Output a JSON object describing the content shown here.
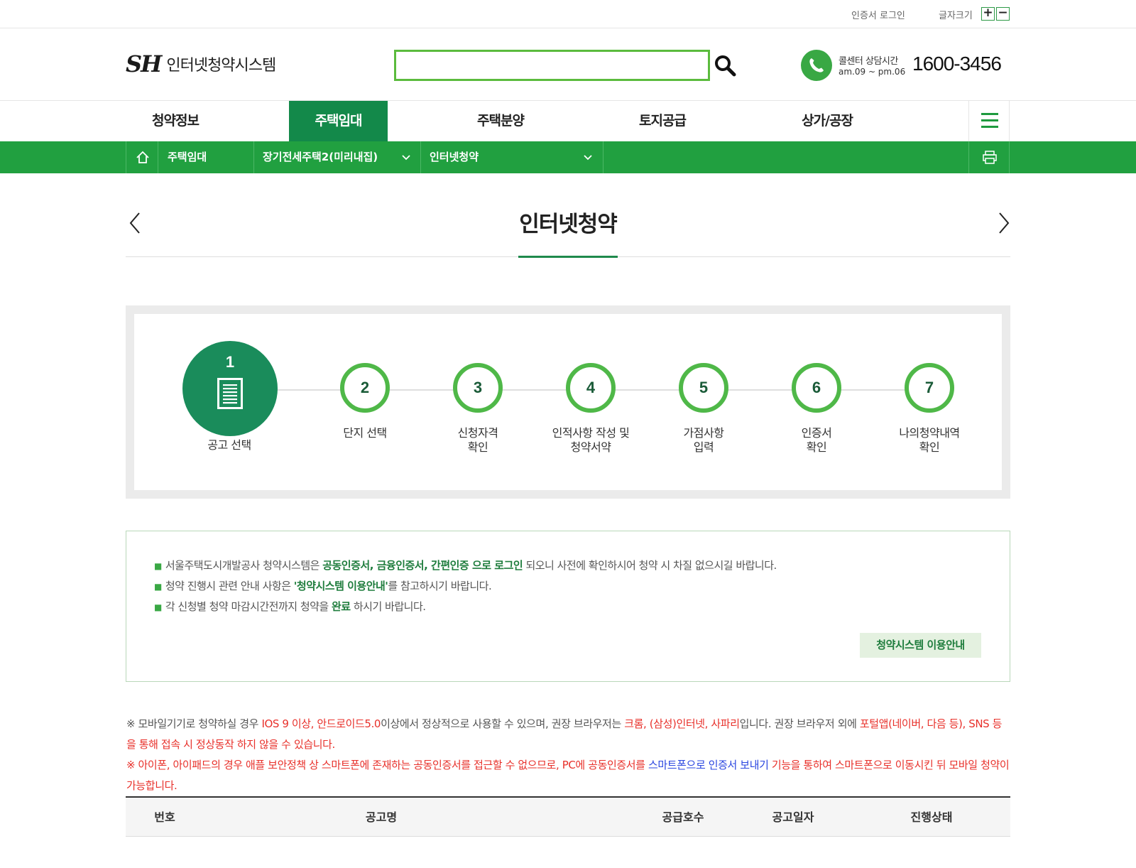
{
  "util": {
    "login": "인증서 로그인",
    "font_size_label": "글자크기",
    "font_plus": "+",
    "font_minus": "−"
  },
  "header": {
    "logo_mark": "SH",
    "logo_text": "인터넷청약시스템",
    "search_placeholder": "",
    "call_label": "콜센터 상담시간",
    "call_hours": "am.09 ~ pm.06",
    "call_number": "1600-3456"
  },
  "gnb": {
    "items": [
      "청약정보",
      "주택임대",
      "주택분양",
      "토지공급",
      "상가/공장"
    ],
    "active_index": 1
  },
  "location": {
    "home": "주택임대",
    "depth2": "장기전세주택2(미리내집)",
    "depth3": "인터넷청약"
  },
  "page": {
    "title": "인터넷청약"
  },
  "steps": [
    {
      "num": "1",
      "label": "공고 선택",
      "active": true
    },
    {
      "num": "2",
      "label": "단지 선택"
    },
    {
      "num": "3",
      "label": "신청자격\n확인"
    },
    {
      "num": "4",
      "label": "인적사항 작성 및\n청약서약"
    },
    {
      "num": "5",
      "label": "가점사항\n입력"
    },
    {
      "num": "6",
      "label": "인증서\n확인"
    },
    {
      "num": "7",
      "label": "나의청약내역\n확인"
    }
  ],
  "notice": {
    "l1_a": "서울주택도시개발공사 청약시스템은 ",
    "l1_b": "공동인증서, 금융인증서, 간편인증 으로 로그인",
    "l1_c": " 되오니 사전에 확인하시어 청약 시 차질 없으시길 바랍니다.",
    "l2_a": "청약 진행시 관련 안내 사항은 ",
    "l2_b": "'청약시스템 이용안내'",
    "l2_c": "를 참고하시기 바랍니다.",
    "l3_a": "각 신청별 청약 마감시간전까지 청약을 ",
    "l3_b": "완료",
    "l3_c": " 하시기 바랍니다.",
    "guide_button": "청약시스템 이용안내"
  },
  "mobile_notes": {
    "n1_a": "※ 모바일기기로 청약하실 경우 ",
    "n1_b": "IOS 9 이상, 안드로이드5.0",
    "n1_c": "이상에서 정상적으로 사용할 수 있으며, 권장 브라우저는 ",
    "n1_d": "크롬, (삼성)인터넷, 사파리",
    "n1_e": "입니다. 권장 브라우저 외에 ",
    "n1_f": "포털앱(네이버, 다음 등), SNS 등을 통해 접속 시 정상동작 하지 않을 수 있습니다.",
    "n2_a": "※ 아이폰, 아이패드의 경우 애플 보안정책 상 스마트폰에 존재하는 공동인증서를 접근할 수 없으므로, PC에 공동인증서를 ",
    "n2_b": "스마트폰으로 인증서 보내기",
    "n2_c": " 기능을 통하여 스마트폰으로 이동시킨 뒤 모바일 청약이 가능합니다."
  },
  "table": {
    "headers": [
      "번호",
      "공고명",
      "공급호수",
      "공고일자",
      "진행상태"
    ]
  },
  "colors": {
    "primary_green": "#13894a",
    "bar_green": "#21a040",
    "step_ring": "#4fb848",
    "notice_red": "#e8302a",
    "notice_blue": "#2a46e0"
  }
}
